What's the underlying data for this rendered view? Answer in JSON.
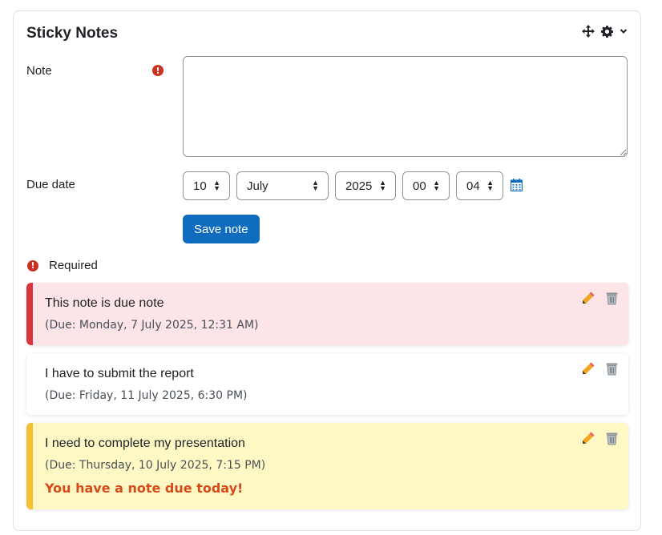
{
  "block": {
    "title": "Sticky Notes",
    "controls": {
      "move_icon": "move-icon",
      "settings_icon": "gear-icon",
      "menu_icon": "chevron-down-icon"
    }
  },
  "form": {
    "note_label": "Note",
    "note_value": "",
    "due_label": "Due date",
    "due": {
      "day": "10",
      "month": "July",
      "year": "2025",
      "hour": "00",
      "minute": "04"
    },
    "save_label": "Save note",
    "required_text": "Required",
    "required_icon": "!"
  },
  "notes": [
    {
      "text": "This note is due note",
      "due": "(Due: Monday, 7 July 2025, 12:31 AM)",
      "style": "overdue"
    },
    {
      "text": "I have to submit the report",
      "due": "(Due: Friday, 11 July 2025, 6:30 PM)",
      "style": "normal"
    },
    {
      "text": "I need to complete my presentation",
      "due": "(Due: Thursday, 10 July 2025, 7:15 PM)",
      "style": "due-today",
      "alert": "You have a note due today!"
    }
  ],
  "colors": {
    "primary": "#0f6cbf",
    "required": "#ca3120",
    "overdue_bg": "#fde4e6",
    "overdue_border": "#d9353f",
    "today_bg": "#fef8c4",
    "today_border": "#f4c02f",
    "alert_text": "#d54a1b"
  }
}
